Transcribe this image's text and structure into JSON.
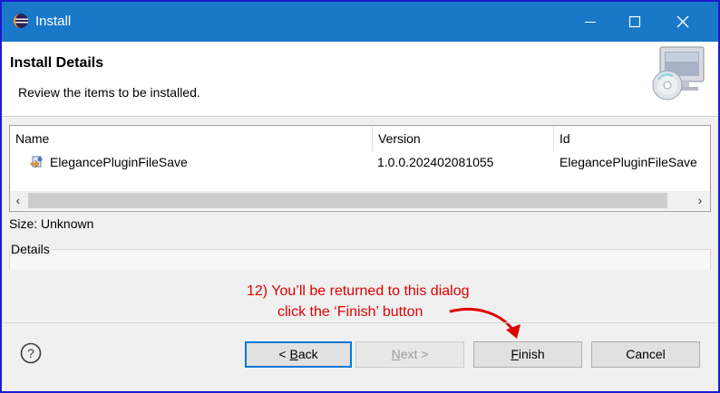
{
  "window": {
    "title": "Install"
  },
  "header": {
    "title": "Install Details",
    "description": "Review the items to be installed."
  },
  "table": {
    "columns": [
      "Name",
      "Version",
      "Id"
    ],
    "rows": [
      {
        "name": "ElegancePluginFileSave",
        "version": "1.0.0.202402081055",
        "id": "ElegancePluginFileSave"
      }
    ]
  },
  "size_label": "Size: Unknown",
  "details_label": "Details",
  "annotation": {
    "line1": "12) You’ll be returned to this dialog",
    "line2": "click the ‘Finish’ button",
    "color": "#e00000"
  },
  "buttons": {
    "back_prefix": "< ",
    "back_key": "B",
    "back_rest": "ack",
    "next_key": "N",
    "next_rest": "ext >",
    "finish_key": "F",
    "finish_rest": "inish",
    "cancel": "Cancel"
  },
  "icons": {
    "app": "eclipse-icon",
    "minimize": "minimize-icon",
    "maximize": "maximize-icon",
    "close": "close-icon",
    "banner": "computer-cd-icon",
    "plugin": "plugin-icon",
    "help": "help-icon",
    "scroll_left": "chevron-left-icon",
    "scroll_right": "chevron-right-icon",
    "arrow": "red-arrow-icon"
  },
  "colors": {
    "titlebar": "#1978c8",
    "frame": "#1c1cd0",
    "accent": "#0078d7"
  }
}
